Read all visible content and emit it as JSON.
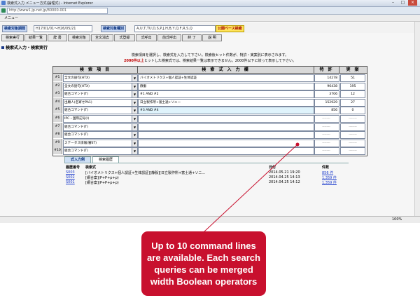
{
  "window": {
    "title": "検索式入力 メニュー方式(論理式) - Internet Explorer",
    "address": "http://www1.jp-net.jp/80000-001",
    "menu": "メニュー"
  },
  "header": {
    "date_label": "検索対象期間",
    "date_value": "H17/01/01～H26/05/21",
    "type_label": "検索対象種別",
    "type_value": "A,U,T,TU,D,S,P,J,H,B,Y,Q,F,R,S,Q",
    "basic_button": "公開ベース検索"
  },
  "tabs": [
    "検索実行",
    "結果一覧",
    "辞 書",
    "検索対象",
    "全文消去",
    "式登録",
    "式呼出",
    "前式呼出",
    "終 了",
    "説 明"
  ],
  "section_title": "検索式入力・検索実行",
  "instructions": {
    "line1": "検索項目を選択し、検索式を入力して下さい。検索後ヒット件数が、特許・実案別に表示されます。",
    "line2_red": "2000件以上",
    "line2_rest": "ヒットした検索式では、検索結果一覧は表示できません。2000件以下に絞って表示して下さい。"
  },
  "grid": {
    "col_item": "検 索 項 目",
    "col_expr": "検 索 式 入 力 欄",
    "col_patent": "特 許",
    "col_utility": "実 案",
    "rows": [
      {
        "num": "#1",
        "item": "全文の語句(HTX)",
        "expr": "バイオメトリクス+個人認証+生体認証",
        "patent": "14278",
        "utility": "51"
      },
      {
        "num": "#2",
        "item": "全文の語句(HTX)",
        "expr": "静脈",
        "patent": "96438",
        "utility": "195"
      },
      {
        "num": "#3",
        "item": "組合コマンド(T)",
        "expr": "#1 AND #2",
        "patent": "3706",
        "utility": "12"
      },
      {
        "num": "#4",
        "item": "出願人(名寄せPA1)",
        "expr": "日立製作所+富士通+ソニー",
        "patent": "152929",
        "utility": "27"
      },
      {
        "num": "#5",
        "item": "組合コマンド(T)",
        "expr": "#3 AND #4",
        "patent": "856",
        "utility": "0"
      },
      {
        "num": "#6",
        "item": "IPC・国際記号(I)",
        "expr": "",
        "patent": "-------",
        "utility": "-------"
      },
      {
        "num": "#7",
        "item": "組合コマンド(T)",
        "expr": "",
        "patent": "-------",
        "utility": "-------"
      },
      {
        "num": "#8",
        "item": "組合コマンド(T)",
        "expr": "",
        "patent": "-------",
        "utility": "-------"
      },
      {
        "num": "#9",
        "item": "ステータス情報(審ST)",
        "expr": "",
        "patent": "-------",
        "utility": "-------"
      },
      {
        "num": "#10",
        "item": "組合コマンド(T)",
        "expr": "",
        "patent": "-------",
        "utility": "-------"
      }
    ]
  },
  "history": {
    "tab_input": "式入力例",
    "tab_history": "検索履歴",
    "col_num": "履歴番号",
    "col_expr": "検索式",
    "col_date": "日付",
    "col_count": "件数",
    "rows": [
      {
        "num": "S003",
        "expr": "[バイオメトリクス+個人認証+生体認証][静脈][日立製作所+富士通+ソニ...",
        "date": "2014.05.21 19:20",
        "count": "856 件"
      },
      {
        "num": "S002",
        "expr": "[網合案](P+P+p+p)",
        "date": "2014.04.25 14:13",
        "count": "1,359 件"
      },
      {
        "num": "S001",
        "expr": "[網合案](P+P+p+p)",
        "date": "2014.04.25 14:12",
        "count": "1,359 件"
      }
    ]
  },
  "status": {
    "zoom": "100%"
  },
  "callout": {
    "text": "Up to 10 command lines are available. Each search queries can be merged width Boolean operators"
  },
  "colors": {
    "callout": "#c8102e",
    "header_blue": "#c9d9f4",
    "highlight_cell": "#dff3fb"
  }
}
